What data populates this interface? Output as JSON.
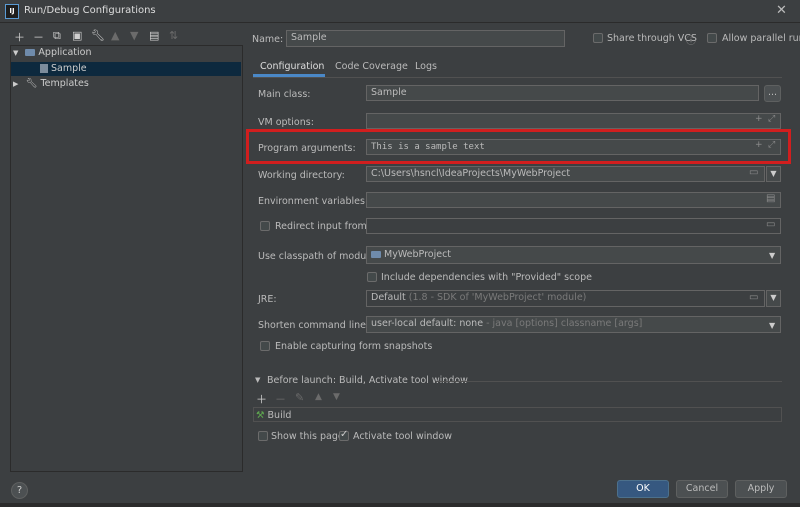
{
  "window": {
    "title": "Run/Debug Configurations",
    "app_icon": "IJ"
  },
  "tree": {
    "application": "Application",
    "sample": "Sample",
    "templates": "Templates"
  },
  "header": {
    "name_label": "Name:",
    "name_value": "Sample",
    "share_vcs": "Share through VCS",
    "allow_parallel": "Allow parallel run"
  },
  "tabs": [
    "Configuration",
    "Code Coverage",
    "Logs"
  ],
  "form": {
    "main_class_label": "Main class:",
    "main_class_value": "Sample",
    "vm_options_label": "VM options:",
    "vm_options_value": "",
    "program_args_label": "Program arguments:",
    "program_args_value": "This is a sample text",
    "working_dir_label": "Working directory:",
    "working_dir_value": "C:\\Users\\hsncl\\IdeaProjects\\MyWebProject",
    "env_vars_label": "Environment variables:",
    "env_vars_value": "",
    "redirect_label": "Redirect input from:",
    "classpath_label": "Use classpath of module:",
    "classpath_value": "MyWebProject",
    "include_deps": "Include dependencies with \"Provided\" scope",
    "jre_label": "JRE:",
    "jre_value_main": "Default",
    "jre_value_detail": "(1.8 - SDK of 'MyWebProject' module)",
    "shorten_label": "Shorten command line:",
    "shorten_value_main": "user-local default: none",
    "shorten_value_detail": " - java [options] classname [args]",
    "capture_snapshots": "Enable capturing form snapshots"
  },
  "before_launch": {
    "title": "Before launch: Build, Activate tool window",
    "items": [
      "Build"
    ],
    "show_page": "Show this page",
    "activate_tool": "Activate tool window"
  },
  "buttons": {
    "ok": "OK",
    "cancel": "Cancel",
    "apply": "Apply",
    "help": "?"
  },
  "colors": {
    "accent": "#4a88c7",
    "highlight_border": "#d11e1e",
    "ok_button": "#365880"
  }
}
